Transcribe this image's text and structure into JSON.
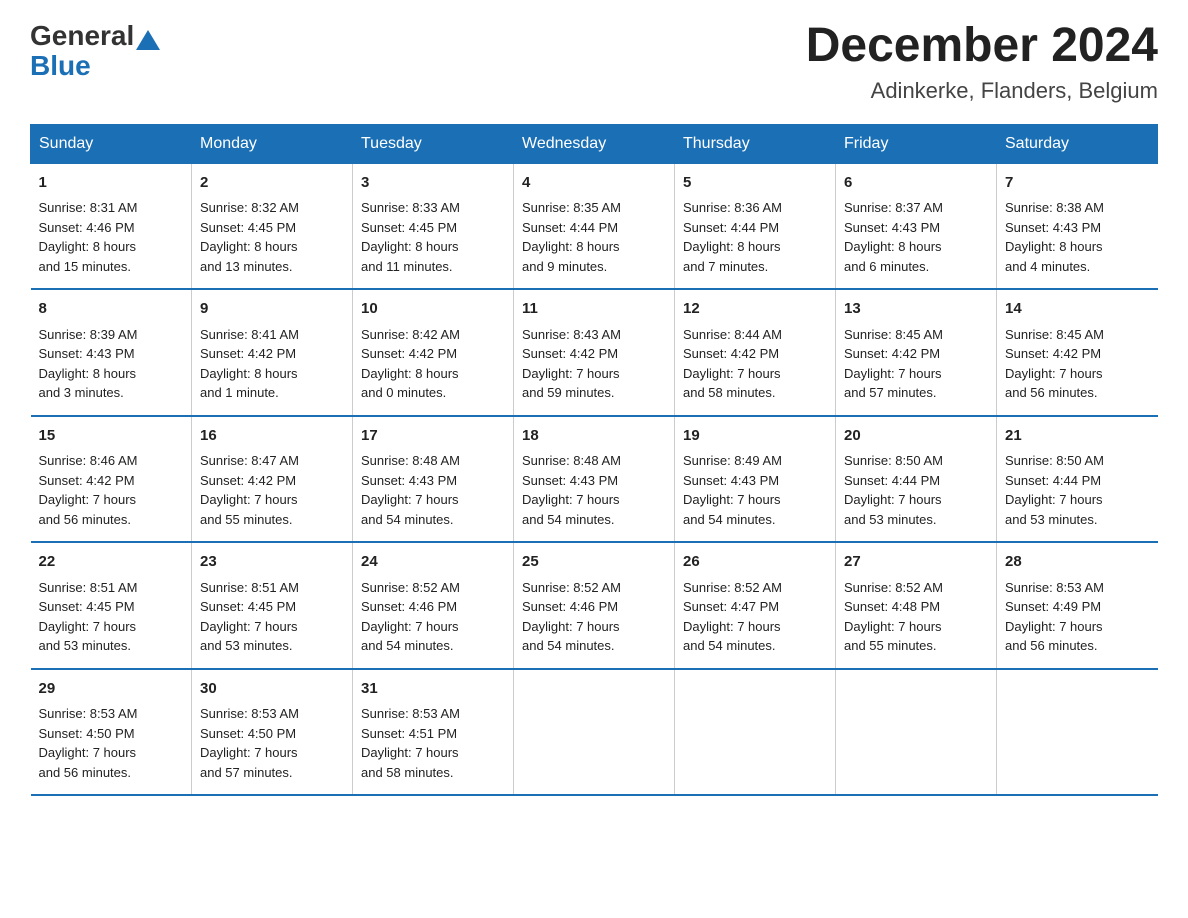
{
  "header": {
    "logo_general": "General",
    "logo_blue": "Blue",
    "month_title": "December 2024",
    "location": "Adinkerke, Flanders, Belgium"
  },
  "days_of_week": [
    "Sunday",
    "Monday",
    "Tuesday",
    "Wednesday",
    "Thursday",
    "Friday",
    "Saturday"
  ],
  "weeks": [
    [
      {
        "day": "1",
        "info": "Sunrise: 8:31 AM\nSunset: 4:46 PM\nDaylight: 8 hours\nand 15 minutes."
      },
      {
        "day": "2",
        "info": "Sunrise: 8:32 AM\nSunset: 4:45 PM\nDaylight: 8 hours\nand 13 minutes."
      },
      {
        "day": "3",
        "info": "Sunrise: 8:33 AM\nSunset: 4:45 PM\nDaylight: 8 hours\nand 11 minutes."
      },
      {
        "day": "4",
        "info": "Sunrise: 8:35 AM\nSunset: 4:44 PM\nDaylight: 8 hours\nand 9 minutes."
      },
      {
        "day": "5",
        "info": "Sunrise: 8:36 AM\nSunset: 4:44 PM\nDaylight: 8 hours\nand 7 minutes."
      },
      {
        "day": "6",
        "info": "Sunrise: 8:37 AM\nSunset: 4:43 PM\nDaylight: 8 hours\nand 6 minutes."
      },
      {
        "day": "7",
        "info": "Sunrise: 8:38 AM\nSunset: 4:43 PM\nDaylight: 8 hours\nand 4 minutes."
      }
    ],
    [
      {
        "day": "8",
        "info": "Sunrise: 8:39 AM\nSunset: 4:43 PM\nDaylight: 8 hours\nand 3 minutes."
      },
      {
        "day": "9",
        "info": "Sunrise: 8:41 AM\nSunset: 4:42 PM\nDaylight: 8 hours\nand 1 minute."
      },
      {
        "day": "10",
        "info": "Sunrise: 8:42 AM\nSunset: 4:42 PM\nDaylight: 8 hours\nand 0 minutes."
      },
      {
        "day": "11",
        "info": "Sunrise: 8:43 AM\nSunset: 4:42 PM\nDaylight: 7 hours\nand 59 minutes."
      },
      {
        "day": "12",
        "info": "Sunrise: 8:44 AM\nSunset: 4:42 PM\nDaylight: 7 hours\nand 58 minutes."
      },
      {
        "day": "13",
        "info": "Sunrise: 8:45 AM\nSunset: 4:42 PM\nDaylight: 7 hours\nand 57 minutes."
      },
      {
        "day": "14",
        "info": "Sunrise: 8:45 AM\nSunset: 4:42 PM\nDaylight: 7 hours\nand 56 minutes."
      }
    ],
    [
      {
        "day": "15",
        "info": "Sunrise: 8:46 AM\nSunset: 4:42 PM\nDaylight: 7 hours\nand 56 minutes."
      },
      {
        "day": "16",
        "info": "Sunrise: 8:47 AM\nSunset: 4:42 PM\nDaylight: 7 hours\nand 55 minutes."
      },
      {
        "day": "17",
        "info": "Sunrise: 8:48 AM\nSunset: 4:43 PM\nDaylight: 7 hours\nand 54 minutes."
      },
      {
        "day": "18",
        "info": "Sunrise: 8:48 AM\nSunset: 4:43 PM\nDaylight: 7 hours\nand 54 minutes."
      },
      {
        "day": "19",
        "info": "Sunrise: 8:49 AM\nSunset: 4:43 PM\nDaylight: 7 hours\nand 54 minutes."
      },
      {
        "day": "20",
        "info": "Sunrise: 8:50 AM\nSunset: 4:44 PM\nDaylight: 7 hours\nand 53 minutes."
      },
      {
        "day": "21",
        "info": "Sunrise: 8:50 AM\nSunset: 4:44 PM\nDaylight: 7 hours\nand 53 minutes."
      }
    ],
    [
      {
        "day": "22",
        "info": "Sunrise: 8:51 AM\nSunset: 4:45 PM\nDaylight: 7 hours\nand 53 minutes."
      },
      {
        "day": "23",
        "info": "Sunrise: 8:51 AM\nSunset: 4:45 PM\nDaylight: 7 hours\nand 53 minutes."
      },
      {
        "day": "24",
        "info": "Sunrise: 8:52 AM\nSunset: 4:46 PM\nDaylight: 7 hours\nand 54 minutes."
      },
      {
        "day": "25",
        "info": "Sunrise: 8:52 AM\nSunset: 4:46 PM\nDaylight: 7 hours\nand 54 minutes."
      },
      {
        "day": "26",
        "info": "Sunrise: 8:52 AM\nSunset: 4:47 PM\nDaylight: 7 hours\nand 54 minutes."
      },
      {
        "day": "27",
        "info": "Sunrise: 8:52 AM\nSunset: 4:48 PM\nDaylight: 7 hours\nand 55 minutes."
      },
      {
        "day": "28",
        "info": "Sunrise: 8:53 AM\nSunset: 4:49 PM\nDaylight: 7 hours\nand 56 minutes."
      }
    ],
    [
      {
        "day": "29",
        "info": "Sunrise: 8:53 AM\nSunset: 4:50 PM\nDaylight: 7 hours\nand 56 minutes."
      },
      {
        "day": "30",
        "info": "Sunrise: 8:53 AM\nSunset: 4:50 PM\nDaylight: 7 hours\nand 57 minutes."
      },
      {
        "day": "31",
        "info": "Sunrise: 8:53 AM\nSunset: 4:51 PM\nDaylight: 7 hours\nand 58 minutes."
      },
      {
        "day": "",
        "info": ""
      },
      {
        "day": "",
        "info": ""
      },
      {
        "day": "",
        "info": ""
      },
      {
        "day": "",
        "info": ""
      }
    ]
  ]
}
